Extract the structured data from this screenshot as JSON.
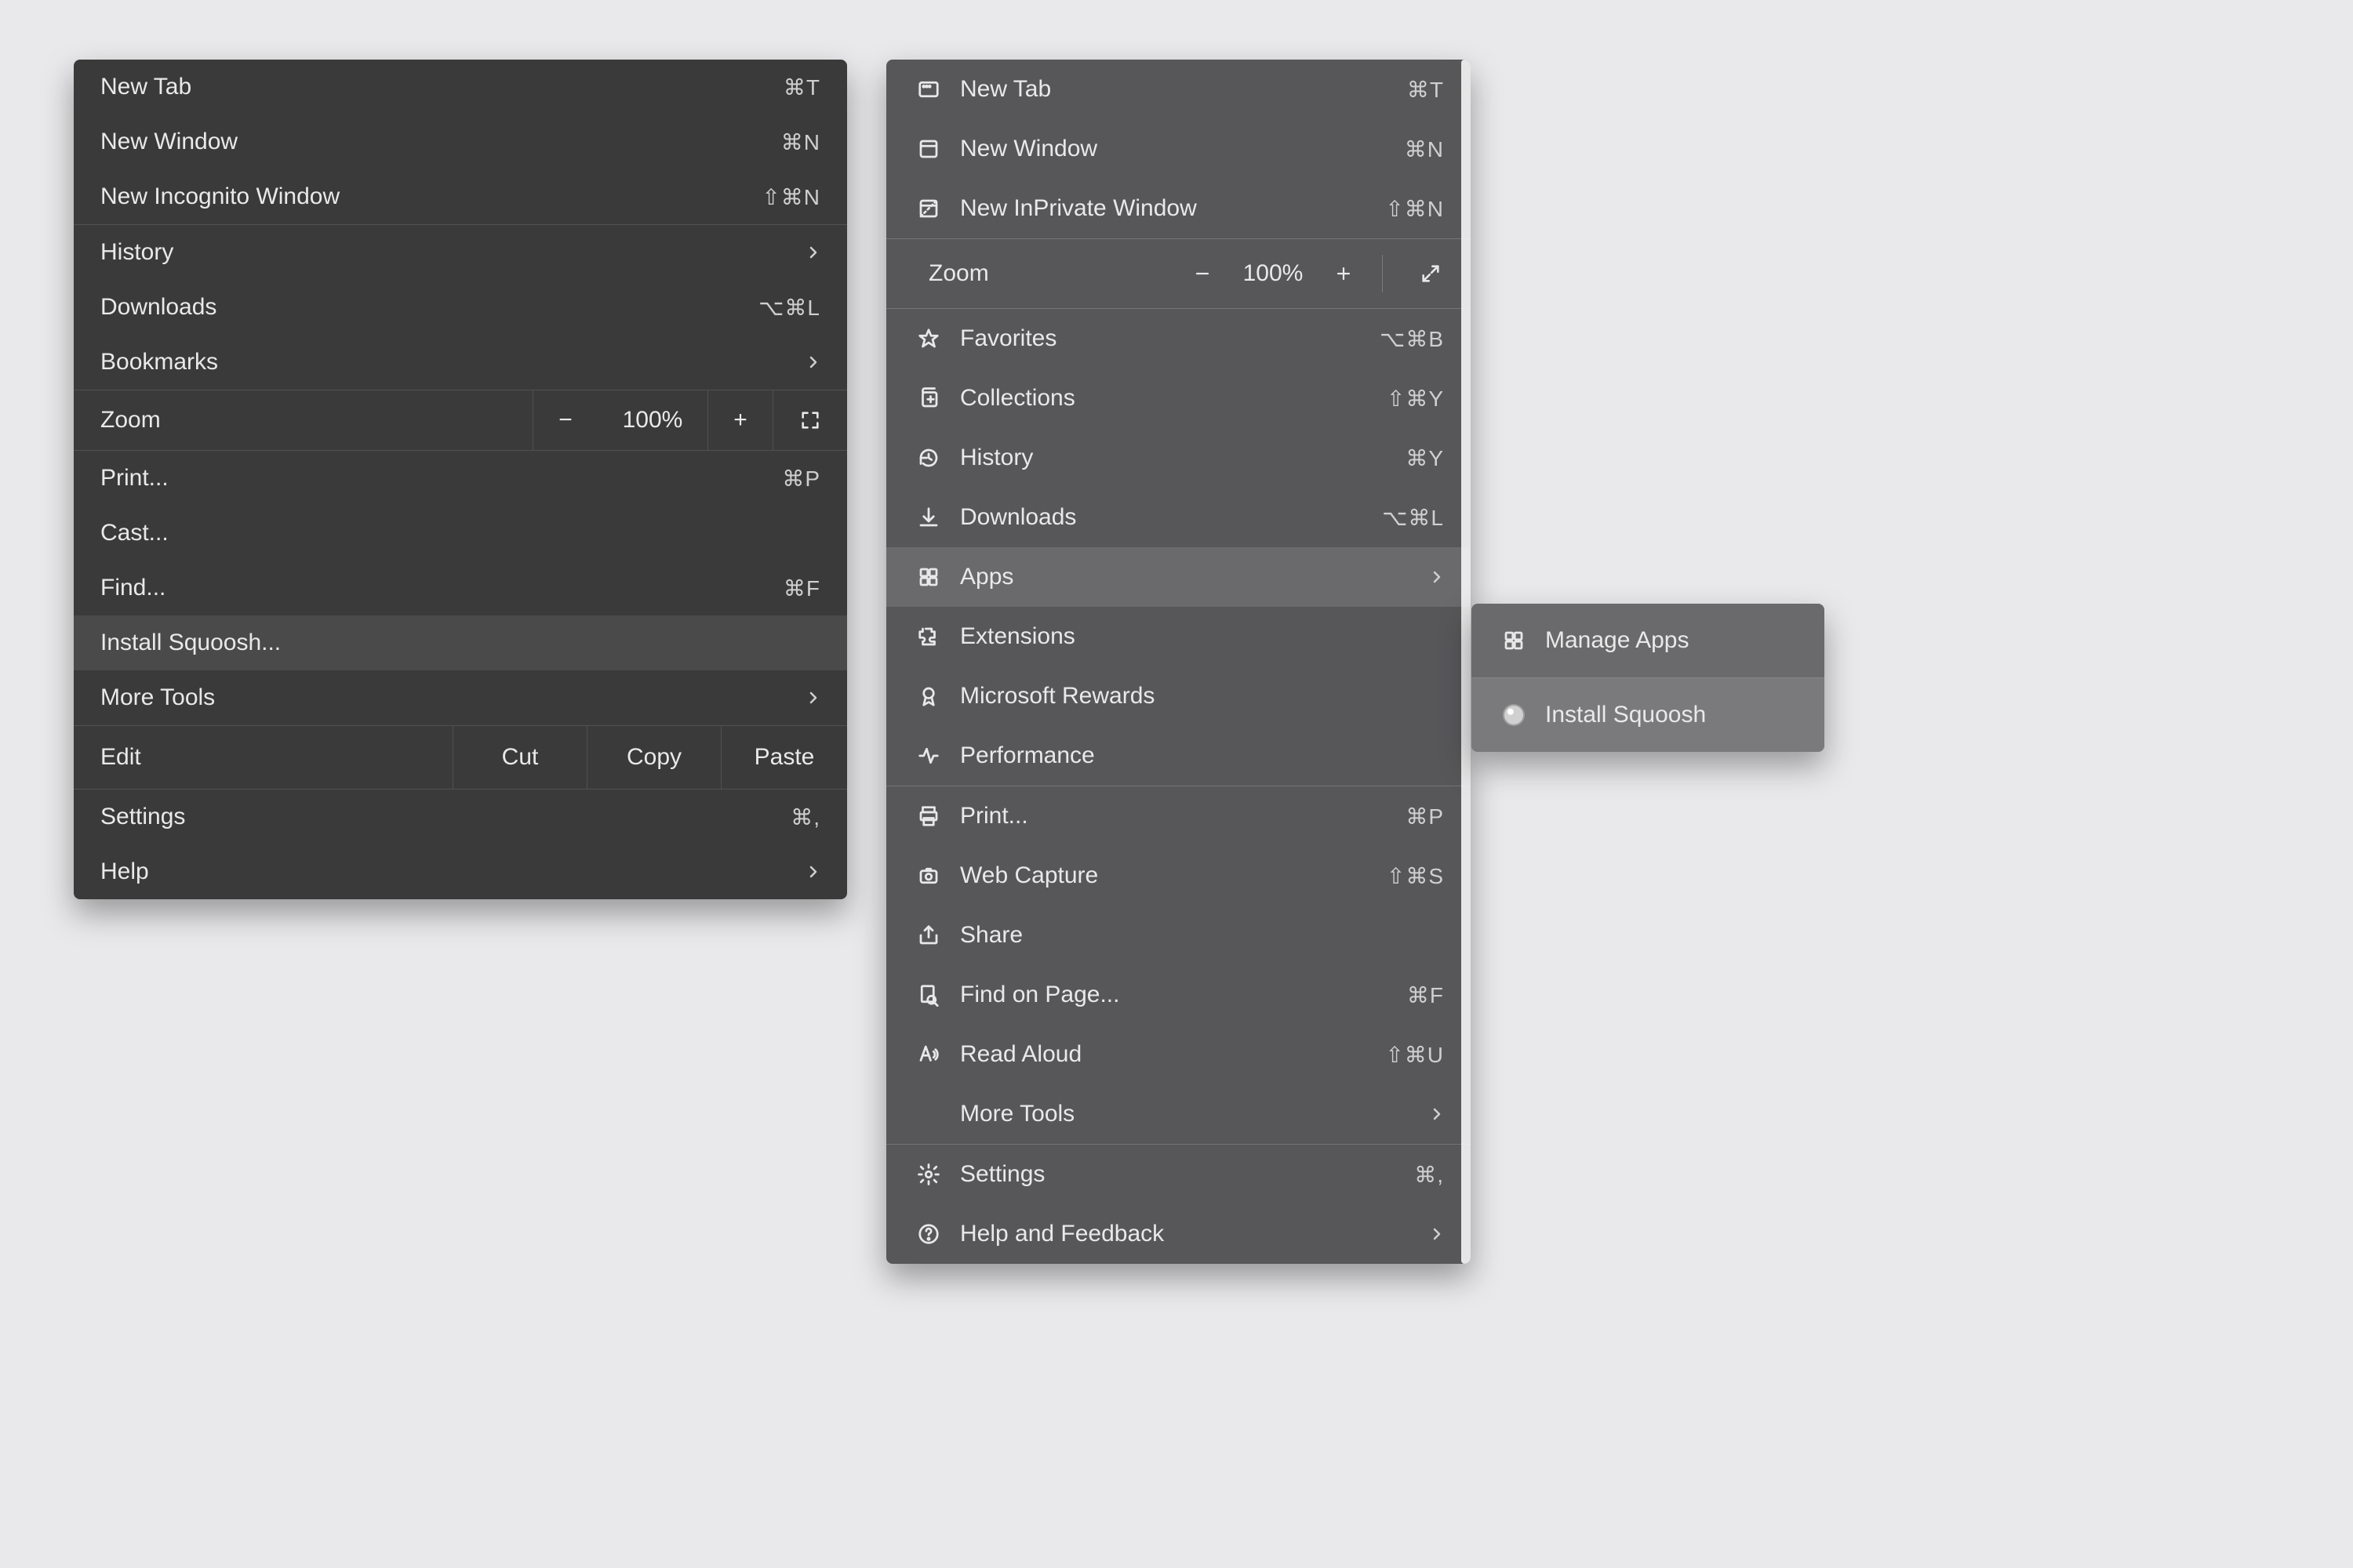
{
  "chrome_menu": {
    "group1": [
      {
        "label": "New Tab",
        "shortcut": "⌘T"
      },
      {
        "label": "New Window",
        "shortcut": "⌘N"
      },
      {
        "label": "New Incognito Window",
        "shortcut": "⇧⌘N"
      }
    ],
    "group2": [
      {
        "label": "History",
        "submenu": true
      },
      {
        "label": "Downloads",
        "shortcut": "⌥⌘L"
      },
      {
        "label": "Bookmarks",
        "submenu": true
      }
    ],
    "zoom": {
      "label": "Zoom",
      "value": "100%",
      "minus": "−",
      "plus": "+"
    },
    "group3": [
      {
        "label": "Print...",
        "shortcut": "⌘P"
      },
      {
        "label": "Cast..."
      },
      {
        "label": "Find...",
        "shortcut": "⌘F"
      },
      {
        "label": "Install Squoosh...",
        "highlight": true
      },
      {
        "label": "More Tools",
        "submenu": true
      }
    ],
    "edit": {
      "label": "Edit",
      "cut": "Cut",
      "copy": "Copy",
      "paste": "Paste"
    },
    "group4": [
      {
        "label": "Settings",
        "shortcut": "⌘,"
      },
      {
        "label": "Help",
        "submenu": true
      }
    ]
  },
  "edge_menu": {
    "group1": [
      {
        "icon": "new-tab-icon",
        "label": "New Tab",
        "shortcut": "⌘T"
      },
      {
        "icon": "new-window-icon",
        "label": "New Window",
        "shortcut": "⌘N"
      },
      {
        "icon": "inprivate-icon",
        "label": "New InPrivate Window",
        "shortcut": "⇧⌘N"
      }
    ],
    "zoom": {
      "label": "Zoom",
      "value": "100%"
    },
    "group2": [
      {
        "icon": "favorites-icon",
        "label": "Favorites",
        "shortcut": "⌥⌘B"
      },
      {
        "icon": "collections-icon",
        "label": "Collections",
        "shortcut": "⇧⌘Y"
      },
      {
        "icon": "history-icon",
        "label": "History",
        "shortcut": "⌘Y"
      },
      {
        "icon": "downloads-icon",
        "label": "Downloads",
        "shortcut": "⌥⌘L"
      },
      {
        "icon": "apps-icon",
        "label": "Apps",
        "submenu": true,
        "highlight": true
      },
      {
        "icon": "extensions-icon",
        "label": "Extensions"
      },
      {
        "icon": "rewards-icon",
        "label": "Microsoft Rewards"
      },
      {
        "icon": "performance-icon",
        "label": "Performance"
      }
    ],
    "group3": [
      {
        "icon": "print-icon",
        "label": "Print...",
        "shortcut": "⌘P"
      },
      {
        "icon": "web-capture-icon",
        "label": "Web Capture",
        "shortcut": "⇧⌘S"
      },
      {
        "icon": "share-icon",
        "label": "Share"
      },
      {
        "icon": "find-icon",
        "label": "Find on Page...",
        "shortcut": "⌘F"
      },
      {
        "icon": "read-aloud-icon",
        "label": "Read Aloud",
        "shortcut": "⇧⌘U"
      },
      {
        "icon": "",
        "label": "More Tools",
        "submenu": true
      }
    ],
    "group4": [
      {
        "icon": "settings-icon",
        "label": "Settings",
        "shortcut": "⌘,"
      },
      {
        "icon": "help-icon",
        "label": "Help and Feedback",
        "submenu": true
      }
    ]
  },
  "apps_submenu": {
    "items": [
      {
        "icon": "apps-icon",
        "label": "Manage Apps"
      },
      {
        "icon": "squoosh-icon",
        "label": "Install Squoosh",
        "highlight": true
      }
    ]
  }
}
